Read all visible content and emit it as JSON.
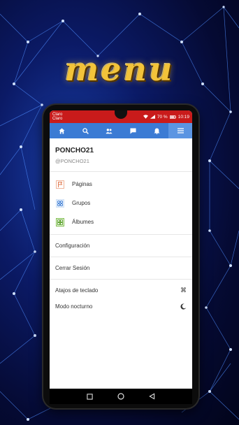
{
  "promo": {
    "title": "menu"
  },
  "status_bar": {
    "carrier_line1": "Claro",
    "carrier_line2": "Claro",
    "battery": "70 %",
    "time": "10:19"
  },
  "nav": {
    "items": [
      {
        "name": "home-icon"
      },
      {
        "name": "search-icon"
      },
      {
        "name": "people-icon"
      },
      {
        "name": "chat-icon"
      },
      {
        "name": "bell-icon"
      },
      {
        "name": "hamburger-menu-icon",
        "active": true
      }
    ],
    "accent": "#3b7bd4"
  },
  "profile": {
    "name": "PONCHO21",
    "handle": "@PONCHO21"
  },
  "menu": {
    "pages": "Páginas",
    "groups": "Grupos",
    "albums": "Álbumes",
    "settings": "Configuración",
    "logout": "Cerrar Sesión",
    "shortcuts": "Atajos de teclado",
    "shortcuts_symbol": "⌘",
    "night_mode": "Modo nocturno"
  },
  "icons": {
    "pages": "flag-icon",
    "groups": "groups-icon",
    "albums": "albums-icon",
    "night": "moon-icon"
  }
}
